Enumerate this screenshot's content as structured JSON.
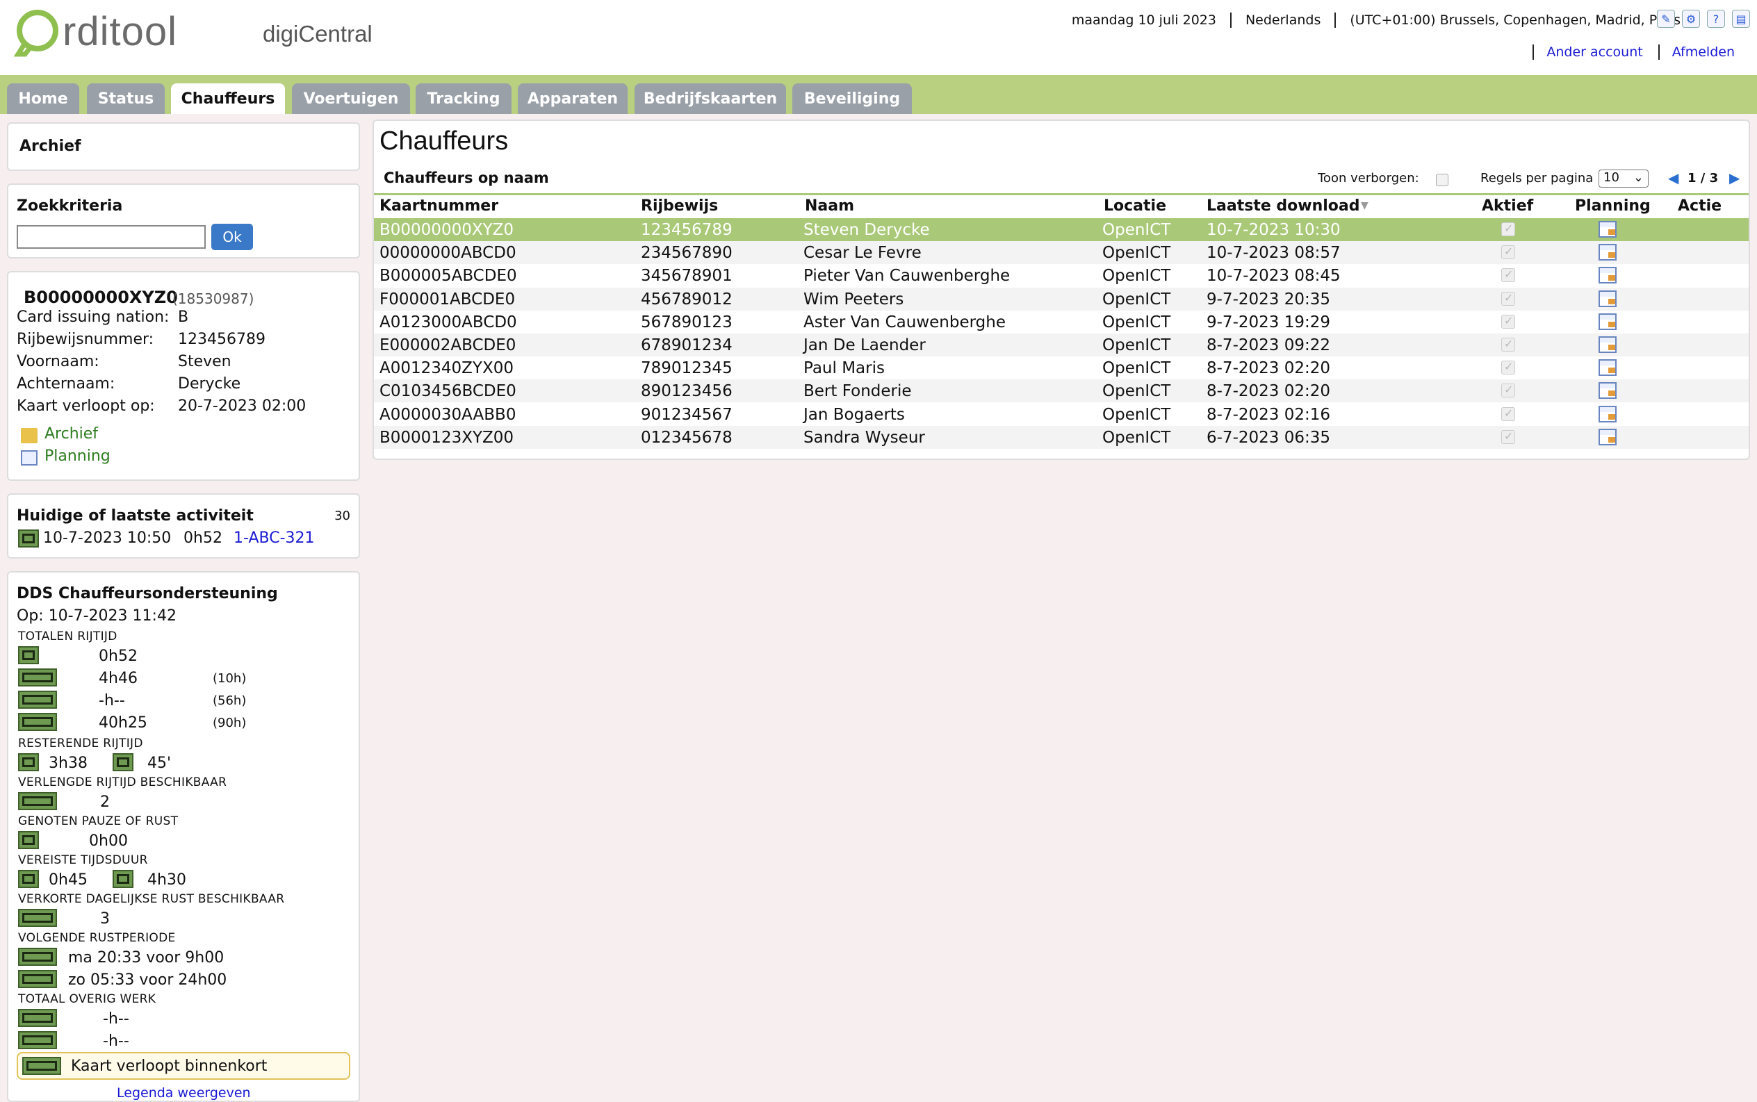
{
  "header": {
    "logo_text": "rditool",
    "app_name": "digiCentral",
    "date": "maandag 10 juli 2023",
    "language": "Nederlands",
    "timezone": "(UTC+01:00) Brussels, Copenhagen, Madrid, Paris",
    "links": {
      "other_account": "Ander account",
      "logout": "Afmelden"
    }
  },
  "tabs": [
    "Home",
    "Status",
    "Chauffeurs",
    "Voertuigen",
    "Tracking",
    "Apparaten",
    "Bedrijfskaarten",
    "Beveiliging"
  ],
  "active_tab": "Chauffeurs",
  "sidebar": {
    "archive_title": "Archief",
    "search": {
      "title": "Zoekkriteria",
      "value": "",
      "ok_label": "Ok"
    },
    "driver": {
      "card": "B00000000XYZ0",
      "id": "(18530987)",
      "fields": [
        {
          "label": "Card issuing nation:",
          "value": "B"
        },
        {
          "label": "Rijbewijsnummer:",
          "value": "123456789"
        },
        {
          "label": "Voornaam:",
          "value": "Steven"
        },
        {
          "label": "Achternaam:",
          "value": "Derycke"
        },
        {
          "label": "Kaart verloopt op:",
          "value": "20-7-2023 02:00"
        }
      ],
      "links": {
        "archive": "Archief",
        "planning": "Planning"
      }
    },
    "activity": {
      "title": "Huidige of laatste activiteit",
      "count": "30",
      "date": "10-7-2023 10:50",
      "duration": "0h52",
      "plate": "1-ABC-321"
    },
    "dds": {
      "title": "DDS Chauffeursondersteuning",
      "op": "Op: 10-7-2023 11:42",
      "totals_label": "TOTALEN RIJTIJD",
      "totals": [
        {
          "value": "0h52",
          "limit": ""
        },
        {
          "value": "4h46",
          "limit": "(10h)"
        },
        {
          "value": "-h--",
          "limit": "(56h)"
        },
        {
          "value": "40h25",
          "limit": "(90h)"
        }
      ],
      "remaining_label": "RESTERENDE RIJTIJD",
      "remaining": {
        "drive": "3h38",
        "pause": "45'"
      },
      "extended_label": "VERLENGDE RIJTIJD BESCHIKBAAR",
      "extended": "2",
      "pause_label": "GENOTEN PAUZE OF RUST",
      "pause": "0h00",
      "required_label": "VEREISTE TIJDSDUUR",
      "required": {
        "rest": "0h45",
        "drive": "4h30"
      },
      "shortened_label": "VERKORTE DAGELIJKSE RUST BESCHIKBAAR",
      "shortened": "3",
      "next_rest_label": "VOLGENDE RUSTPERIODE",
      "next_rest": [
        "ma 20:33 voor 9h00",
        "zo 05:33 voor 24h00"
      ],
      "other_work_label": "TOTAAL OVERIG WERK",
      "other_work": [
        "-h--",
        "-h--"
      ],
      "warning": "Kaart verloopt binnenkort",
      "legend_link": "Legenda weergeven"
    }
  },
  "main": {
    "title": "Chauffeurs",
    "subtitle": "Chauffeurs op naam",
    "show_hidden_label": "Toon verborgen:",
    "rows_per_page_label": "Regels per pagina",
    "rows_per_page": "10",
    "pager": "1 / 3",
    "columns": [
      "Kaartnummer",
      "Rijbewijs",
      "Naam",
      "Locatie",
      "Laatste download",
      "Aktief",
      "Planning",
      "Actie"
    ],
    "rows": [
      {
        "card": "B00000000XYZ0",
        "license": "123456789",
        "name": "Steven Derycke",
        "location": "OpenICT",
        "download": "10-7-2023 10:30"
      },
      {
        "card": "00000000ABCD0",
        "license": "234567890",
        "name": "Cesar Le Fevre",
        "location": "OpenICT",
        "download": "10-7-2023 08:57"
      },
      {
        "card": "B000005ABCDE0",
        "license": "345678901",
        "name": "Pieter Van Cauwenberghe",
        "location": "OpenICT",
        "download": "10-7-2023 08:45"
      },
      {
        "card": "F000001ABCDE0",
        "license": "456789012",
        "name": "Wim Peeters",
        "location": "OpenICT",
        "download": "9-7-2023 20:35"
      },
      {
        "card": "A0123000ABCD0",
        "license": "567890123",
        "name": "Aster Van Cauwenberghe",
        "location": "OpenICT",
        "download": "9-7-2023 19:29"
      },
      {
        "card": "E000002ABCDE0",
        "license": "678901234",
        "name": "Jan De Laender",
        "location": "OpenICT",
        "download": "8-7-2023 09:22"
      },
      {
        "card": "A0012340ZYX00",
        "license": "789012345",
        "name": "Paul Maris",
        "location": "OpenICT",
        "download": "8-7-2023 02:20"
      },
      {
        "card": "C0103456BCDE0",
        "license": "890123456",
        "name": "Bert Fonderie",
        "location": "OpenICT",
        "download": "8-7-2023 02:20"
      },
      {
        "card": "A0000030AABB0",
        "license": "901234567",
        "name": "Jan Bogaerts",
        "location": "OpenICT",
        "download": "8-7-2023 02:16"
      },
      {
        "card": "B0000123XYZ00",
        "license": "012345678",
        "name": "Sandra Wyseur",
        "location": "OpenICT",
        "download": "6-7-2023 06:35"
      }
    ]
  },
  "colors": {
    "accent": "#b8d080",
    "selected_row": "#a9c978",
    "tab": "#9aa0a8",
    "link": "#1a1ad6"
  }
}
